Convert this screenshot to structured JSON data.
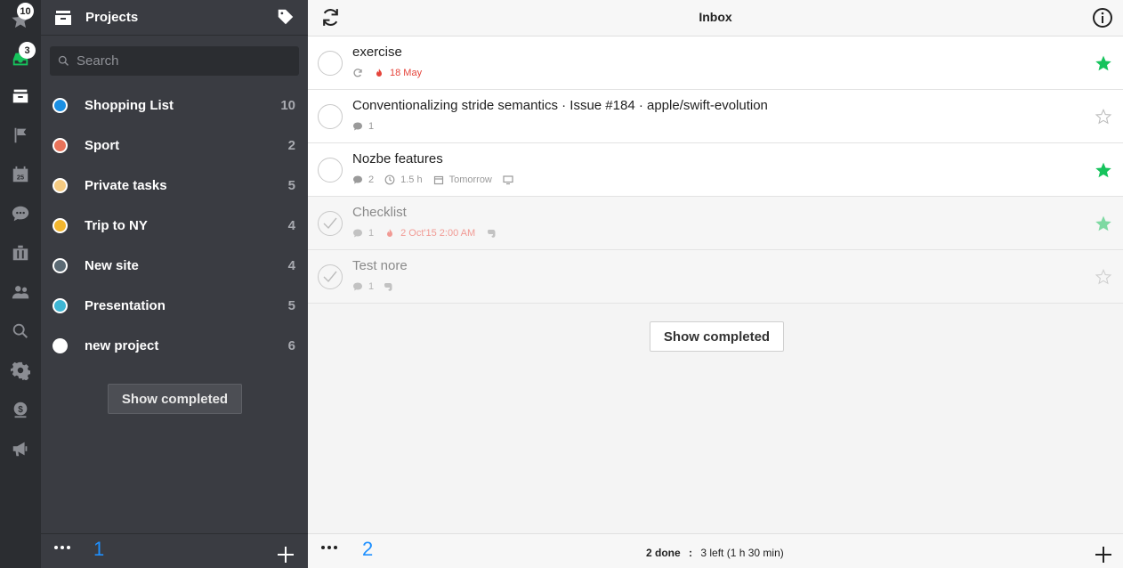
{
  "rail": {
    "priority_badge": "10",
    "inbox_badge": "3"
  },
  "projects_panel": {
    "title": "Projects",
    "search_placeholder": "Search",
    "items": [
      {
        "name": "Shopping List",
        "count": "10",
        "color": "#1a8fe3"
      },
      {
        "name": "Sport",
        "count": "2",
        "color": "#e8735a"
      },
      {
        "name": "Private tasks",
        "count": "5",
        "color": "#f5cb82"
      },
      {
        "name": "Trip to NY",
        "count": "4",
        "color": "#f2b62f"
      },
      {
        "name": "New site",
        "count": "4",
        "color": "#5b6a74"
      },
      {
        "name": "Presentation",
        "count": "5",
        "color": "#3fb6d4"
      },
      {
        "name": "new project",
        "count": "6",
        "color": "#ffffff"
      }
    ],
    "show_completed": "Show completed",
    "footer_number": "1"
  },
  "main": {
    "title": "Inbox",
    "tasks": [
      {
        "title": "exercise",
        "meta": {
          "due": "18 May"
        },
        "starred": true,
        "done": false
      },
      {
        "title": "Conventionalizing stride semantics · Issue #184 · apple/swift-evolution",
        "meta": {
          "comments": "1"
        },
        "starred": false,
        "done": false
      },
      {
        "title": "Nozbe features",
        "meta": {
          "comments": "2",
          "time": "1.5 h",
          "date": "Tomorrow"
        },
        "starred": true,
        "done": false
      },
      {
        "title": "Checklist",
        "meta": {
          "comments": "1",
          "due": "2 Oct'15 2:00 AM"
        },
        "starred": true,
        "done": true
      },
      {
        "title": "Test nore",
        "meta": {
          "comments": "1"
        },
        "starred": false,
        "done": true
      }
    ],
    "show_completed": "Show completed",
    "footer_number": "2",
    "status": {
      "done": "2 done",
      "separator": ":",
      "left": "3 left (1 h 30 min)"
    }
  },
  "colors": {
    "accent_green": "#16c35c",
    "hot_red": "#e5443b",
    "link_blue": "#1e90ff"
  }
}
